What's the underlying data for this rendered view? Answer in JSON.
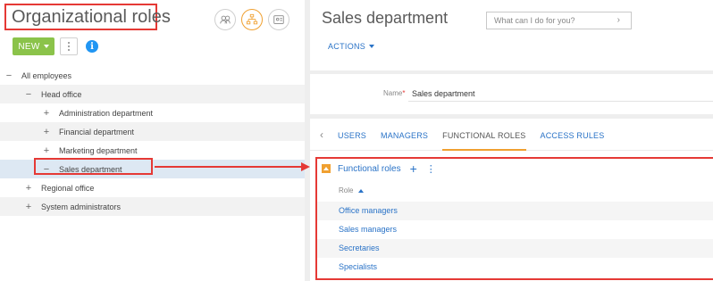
{
  "left": {
    "title": "Organizational roles",
    "new_label": "NEW",
    "info_label": "i",
    "tree": [
      {
        "toggle": "−",
        "label": "All employees",
        "level": 0
      },
      {
        "toggle": "−",
        "label": "Head office",
        "level": 1
      },
      {
        "toggle": "+",
        "label": "Administration department",
        "level": 2
      },
      {
        "toggle": "+",
        "label": "Financial department",
        "level": 2
      },
      {
        "toggle": "+",
        "label": "Marketing department",
        "level": 2
      },
      {
        "toggle": "−",
        "label": "Sales department",
        "level": 2,
        "selected": true
      },
      {
        "toggle": "+",
        "label": "Regional office",
        "level": 1
      },
      {
        "toggle": "+",
        "label": "System administrators",
        "level": 1
      }
    ]
  },
  "right": {
    "title": "Sales department",
    "search_placeholder": "What can I do for you?",
    "actions_label": "ACTIONS",
    "name_label": "Name",
    "name_required": "*",
    "name_value": "Sales department",
    "tabs": [
      "USERS",
      "MANAGERS",
      "FUNCTIONAL ROLES",
      "ACCESS RULES"
    ],
    "active_tab": "FUNCTIONAL ROLES",
    "detail_title": "Functional roles",
    "column_header": "Role",
    "roles": [
      "Office managers",
      "Sales managers",
      "Secretaries",
      "Specialists"
    ]
  },
  "colors": {
    "accent": "#2a73c7",
    "highlight": "#e53935",
    "new_button": "#8bc34a",
    "active_view": "#f0a030"
  }
}
